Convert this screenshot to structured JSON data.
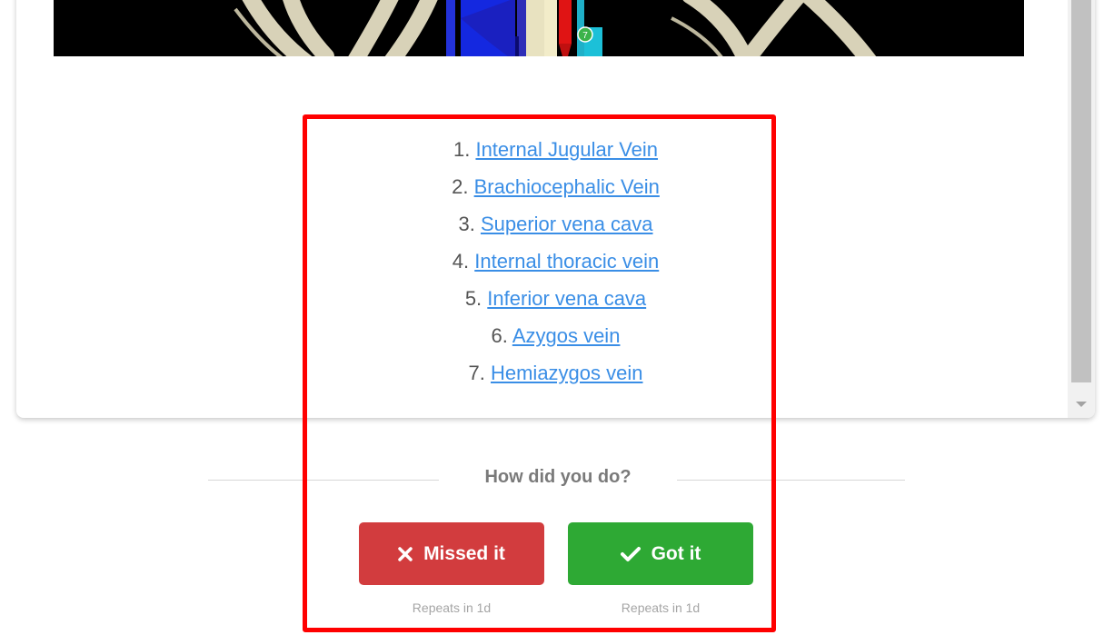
{
  "viewer": {
    "marker_number": "7",
    "image_alt": "3D anatomy view of thoracic veins and ribs"
  },
  "answers": {
    "items": [
      {
        "number": "1.",
        "label": "Internal Jugular Vein"
      },
      {
        "number": "2.",
        "label": "Brachiocephalic Vein"
      },
      {
        "number": "3.",
        "label": "Superior vena cava"
      },
      {
        "number": "4.",
        "label": "Internal thoracic vein"
      },
      {
        "number": "5.",
        "label": "Inferior vena cava"
      },
      {
        "number": "6.",
        "label": "Azygos vein"
      },
      {
        "number": "7.",
        "label": "Hemiazygos vein"
      }
    ]
  },
  "feedback": {
    "prompt": "How did you do?",
    "missed_label": "Missed it",
    "got_label": "Got it",
    "missed_repeat": "Repeats in 1d",
    "got_repeat": "Repeats in 1d"
  },
  "colors": {
    "link": "#3a8ee6",
    "missed": "#d23c3e",
    "got": "#2ea934",
    "highlight": "#ff0000"
  },
  "icons": {
    "missed": "x-icon",
    "got": "checkmark-icon",
    "scroll": "chevron-down-icon"
  }
}
